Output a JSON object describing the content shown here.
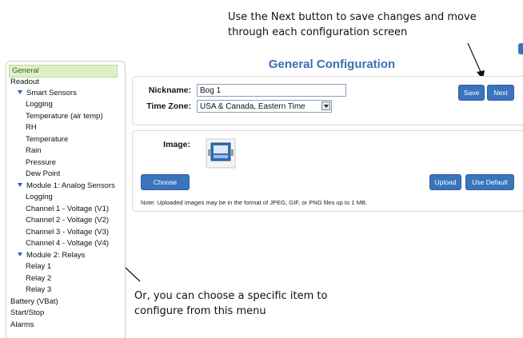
{
  "callouts": {
    "top": "Use the Next button to save changes and move through each configuration screen",
    "bottom": "Or, you can choose a specific item to configure from this menu"
  },
  "sidebar": {
    "items": [
      {
        "label": "General",
        "level": 0,
        "selected": true
      },
      {
        "label": "Readout",
        "level": 0
      },
      {
        "label": "Smart Sensors",
        "level": 1,
        "expanded": true
      },
      {
        "label": "Logging",
        "level": 2
      },
      {
        "label": "Temperature (air temp)",
        "level": 2
      },
      {
        "label": "RH",
        "level": 2
      },
      {
        "label": "Temperature",
        "level": 2
      },
      {
        "label": "Rain",
        "level": 2
      },
      {
        "label": "Pressure",
        "level": 2
      },
      {
        "label": "Dew Point",
        "level": 2
      },
      {
        "label": "Module 1: Analog Sensors",
        "level": 1,
        "expanded": true
      },
      {
        "label": "Logging",
        "level": 2
      },
      {
        "label": "Channel 1 - Voltage (V1)",
        "level": 2
      },
      {
        "label": "Channel 2 - Voltage (V2)",
        "level": 2
      },
      {
        "label": "Channel 3 - Voltage (V3)",
        "level": 2
      },
      {
        "label": "Channel 4 - Voltage (V4)",
        "level": 2
      },
      {
        "label": "Module 2: Relays",
        "level": 1,
        "expanded": true
      },
      {
        "label": "Relay 1",
        "level": 2
      },
      {
        "label": "Relay 2",
        "level": 2
      },
      {
        "label": "Relay 3",
        "level": 2
      },
      {
        "label": "Battery (VBat)",
        "level": 0
      },
      {
        "label": "Start/Stop",
        "level": 0
      },
      {
        "label": "Alarms",
        "level": 0
      }
    ]
  },
  "main": {
    "title": "General Configuration",
    "nickname_label": "Nickname:",
    "nickname_value": "Bog 1",
    "timezone_label": "Time Zone:",
    "timezone_value": "USA & Canada, Eastern Time",
    "save_label": "Save",
    "next_label": "Next",
    "image_label": "Image:",
    "choose_label": "Choose",
    "upload_label": "Upload",
    "use_default_label": "Use Default",
    "note": "Note: Uploaded images may be in the format of JPEG, GIF, or PNG files up to 1 MB."
  },
  "colors": {
    "accent": "#3a74bd",
    "title": "#3b6fb1",
    "selected_bg": "#dff0c9"
  }
}
